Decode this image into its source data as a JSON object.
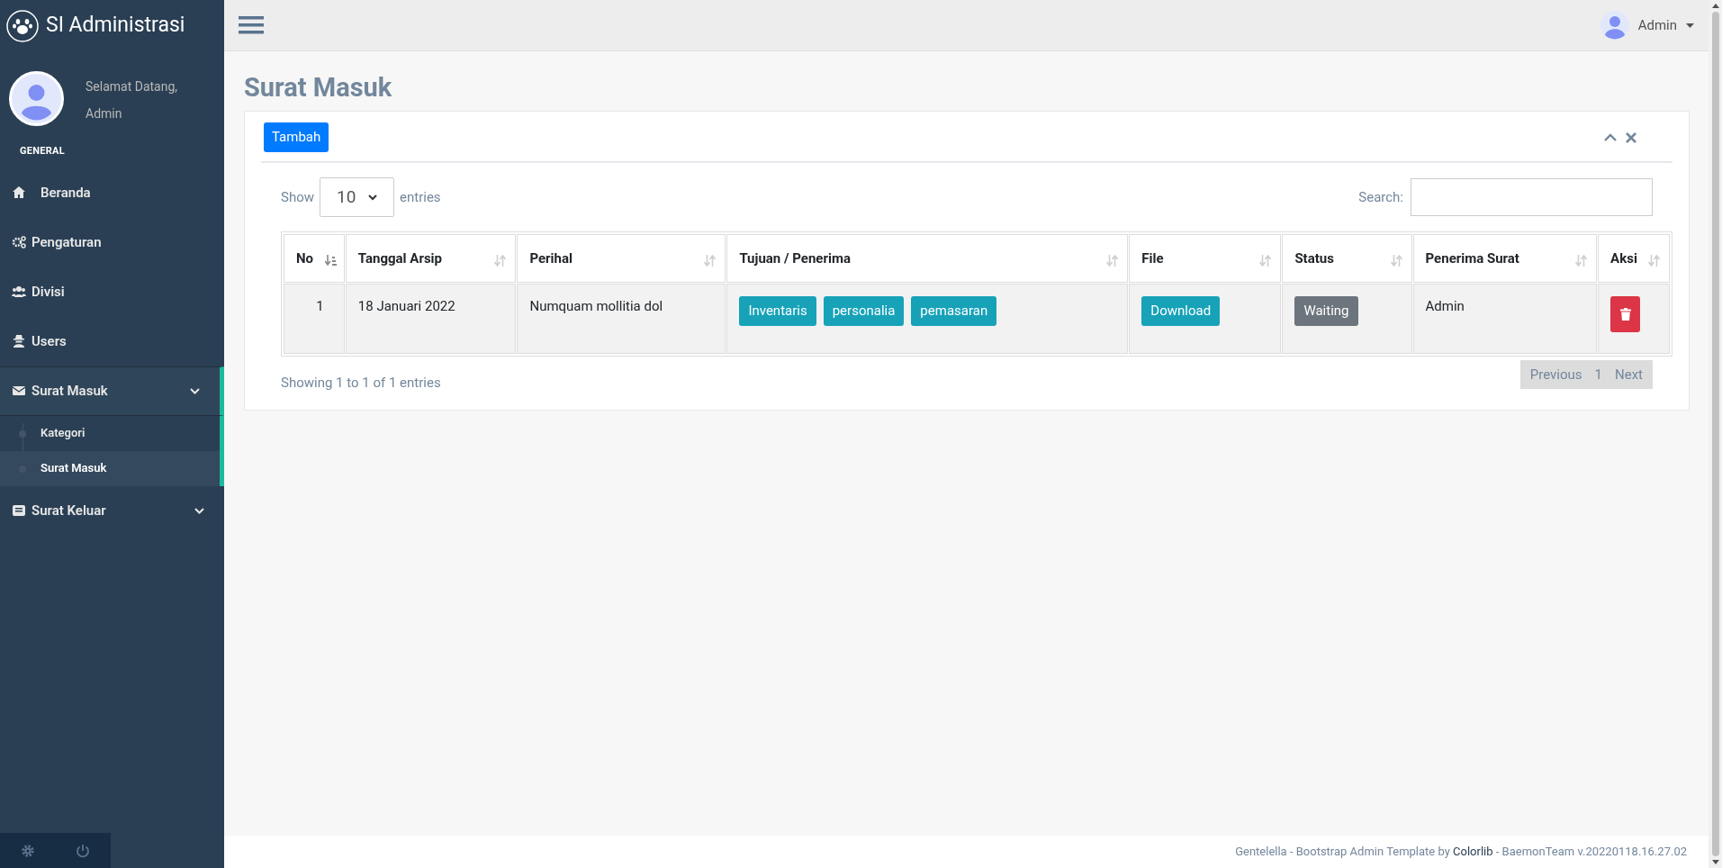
{
  "sidebar": {
    "brand": "SI Administrasi",
    "welcome": "Selamat Datang,",
    "user_name": "Admin",
    "section": "GENERAL",
    "menu": [
      {
        "label": "Beranda",
        "kind": "link",
        "expanded": false
      },
      {
        "label": "Pengaturan",
        "kind": "link",
        "expanded": false
      },
      {
        "label": "Divisi",
        "kind": "link",
        "expanded": false
      },
      {
        "label": "Users",
        "kind": "link",
        "expanded": false
      },
      {
        "label": "Surat Masuk",
        "kind": "group",
        "expanded": true,
        "children": [
          {
            "label": "Kategori",
            "selected": false
          },
          {
            "label": "Surat Masuk",
            "selected": true
          }
        ]
      },
      {
        "label": "Surat Keluar",
        "kind": "group",
        "expanded": false
      }
    ]
  },
  "topbar": {
    "user_name": "Admin"
  },
  "page_title": "Surat Masuk",
  "panel": {
    "add_button": "Tambah",
    "show_label": "Show",
    "page_size": "10",
    "entries_label": "entries",
    "search_label": "Search:",
    "columns": [
      {
        "label": "No",
        "sorted": true
      },
      {
        "label": "Tanggal Arsip",
        "sorted": false
      },
      {
        "label": "Perihal",
        "sorted": false
      },
      {
        "label": "Tujuan / Penerima",
        "sorted": false
      },
      {
        "label": "File",
        "sorted": false
      },
      {
        "label": "Status",
        "sorted": false
      },
      {
        "label": "Penerima Surat",
        "sorted": false
      },
      {
        "label": "Aksi",
        "sorted": false
      }
    ],
    "rows": [
      {
        "no": "1",
        "date": "18 Januari 2022",
        "subject": "Numquam mollitia dol",
        "recipients": [
          "Inventaris",
          "personalia",
          "pemasaran"
        ],
        "file_button": "Download",
        "status": "Waiting",
        "receiver": "Admin"
      }
    ],
    "info": "Showing 1 to 1 of 1 entries",
    "pagination": {
      "previous": "Previous",
      "pages": [
        {
          "label": "1",
          "selected": false
        }
      ],
      "next": "Next"
    }
  },
  "footer": {
    "text": "Gentelella - Bootstrap Admin Template by ",
    "link": "Colorlib",
    "suffix": " - BaemonTeam v.20220118.16.27.02"
  }
}
